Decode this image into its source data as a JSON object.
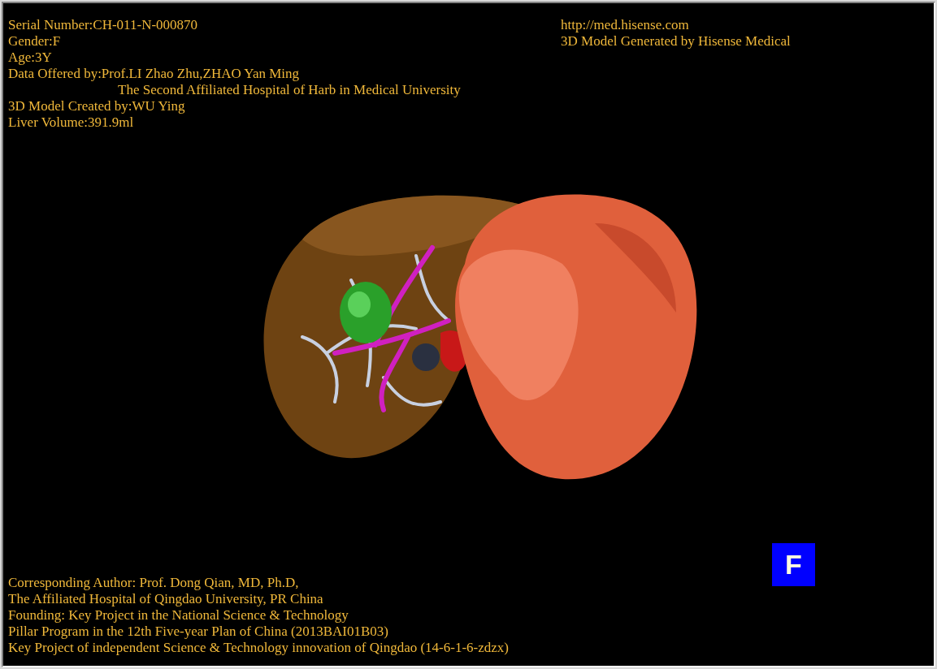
{
  "info_left": [
    {
      "kind": "line",
      "text": "Serial Number:CH-011-N-000870"
    },
    {
      "kind": "line",
      "text": "Gender:F"
    },
    {
      "kind": "line",
      "text": "Age:3Y"
    },
    {
      "kind": "line",
      "text": "Data Offered by:Prof.LI Zhao Zhu,ZHAO Yan Ming"
    },
    {
      "kind": "continuation",
      "text": "The Second Affiliated Hospital of Harb in Medical University"
    },
    {
      "kind": "line",
      "text": "3D Model Created by:WU Ying"
    },
    {
      "kind": "line",
      "text": "Liver Volume:391.9ml"
    }
  ],
  "info_right": [
    "http://med.hisense.com",
    "3D Model Generated by Hisense Medical"
  ],
  "credits": [
    "Corresponding Author: Prof. Dong Qian, MD, Ph.D,",
    "The Affiliated Hospital of Qingdao University, PR China",
    "Founding: Key Project in the National Science & Technology",
    "Pillar Program in the 12th Five-year Plan of China (2013BAI01B03)",
    "Key Project of independent Science & Technology innovation of Qingdao (14-6-1-6-zdzx)"
  ],
  "orientation_label": "F"
}
